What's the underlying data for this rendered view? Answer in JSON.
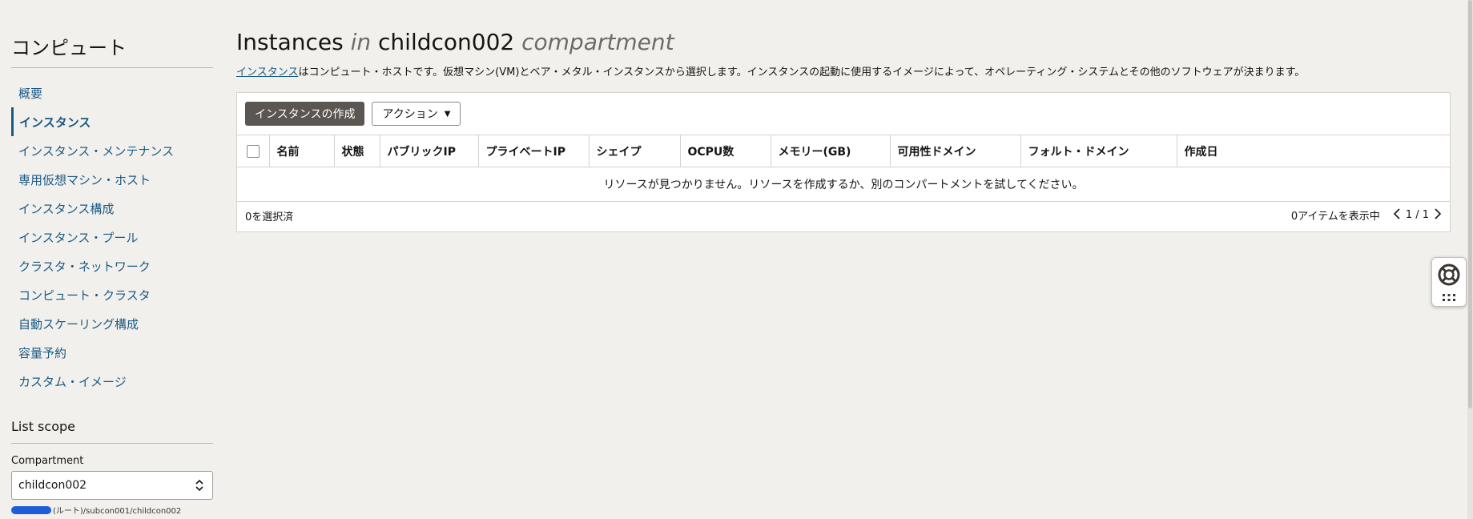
{
  "sidebar": {
    "title": "コンピュート",
    "items": [
      {
        "label": "概要"
      },
      {
        "label": "インスタンス"
      },
      {
        "label": "インスタンス・メンテナンス"
      },
      {
        "label": "専用仮想マシン・ホスト"
      },
      {
        "label": "インスタンス構成"
      },
      {
        "label": "インスタンス・プール"
      },
      {
        "label": "クラスタ・ネットワーク"
      },
      {
        "label": "コンピュート・クラスタ"
      },
      {
        "label": "自動スケーリング構成"
      },
      {
        "label": "容量予約"
      },
      {
        "label": "カスタム・イメージ"
      }
    ],
    "active_item": "インスタンス"
  },
  "scope": {
    "title": "List scope",
    "compartment_label": "Compartment",
    "compartment_value": "childcon002",
    "compartment_path": "(ルート)/subcon001/childcon002"
  },
  "header": {
    "title_part1": "Instances",
    "title_in": "in",
    "title_compartment": "childcon002",
    "title_suffix": "compartment",
    "desc_link": "インスタンス",
    "desc_text": "はコンピュート・ホストです。仮想マシン(VM)とベア・メタル・インスタンスから選択します。インスタンスの起動に使用するイメージによって、オペレーティング・システムとその他のソフトウェアが決まります。"
  },
  "toolbar": {
    "create_label": "インスタンスの作成",
    "actions_label": "アクション"
  },
  "table": {
    "columns": [
      "名前",
      "状態",
      "パブリックIP",
      "プライベートIP",
      "シェイプ",
      "OCPU数",
      "メモリー(GB)",
      "可用性ドメイン",
      "フォルト・ドメイン",
      "作成日"
    ],
    "empty_message": "リソースが見つかりません。リソースを作成するか、別のコンパートメントを試してください。"
  },
  "footer": {
    "selected": "0を選択済",
    "items_shown": "0アイテムを表示中",
    "page": "1 / 1"
  },
  "colors": {
    "link": "#1b5a84",
    "primary_button": "#5b5652",
    "background": "#f2f0ec"
  },
  "icons": [
    "chevron-down-icon",
    "select-chevrons-icon",
    "chevron-left-icon",
    "chevron-right-icon",
    "lifebuoy-icon",
    "apps-grid-icon"
  ]
}
